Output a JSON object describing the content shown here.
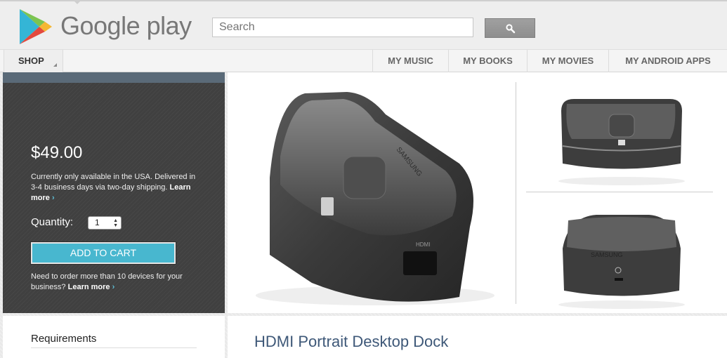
{
  "header": {
    "brand": "Google play",
    "search": {
      "placeholder": "Search",
      "value": ""
    },
    "search_icon": "magnifier-icon"
  },
  "nav": {
    "shop": "SHOP",
    "items": [
      "MY MUSIC",
      "MY BOOKS",
      "MY MOVIES",
      "MY ANDROID APPS"
    ]
  },
  "purchase": {
    "price": "$49.00",
    "availability": "Currently only available in the USA. Delivered in 3-4 business days via two-day shipping.",
    "learn_more": "Learn more",
    "quantity_label": "Quantity:",
    "quantity_value": "1",
    "add_to_cart": "ADD TO CART",
    "bulk_text": "Need to order more than 10 devices for your business?",
    "bulk_learn_more": "Learn more",
    "accent_color": "#48b7cf"
  },
  "product": {
    "title": "HDMI Portrait Desktop Dock",
    "requirements_heading": "Requirements"
  }
}
